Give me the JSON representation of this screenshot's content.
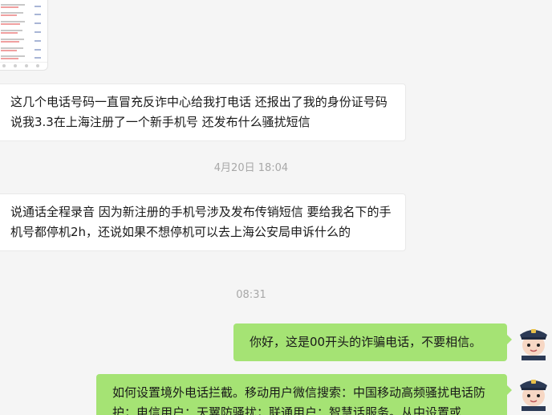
{
  "messages": [
    {
      "side": "in",
      "text": "这几个电话号码一直冒充反诈中心给我打电话 还报出了我的身份证号码 说我3.3在上海注册了一个新手机号 还发布什么骚扰短信"
    },
    {
      "side": "in",
      "text": "说通话全程录音 因为新注册的手机号涉及发布传销短信 要给我名下的手机号都停机2h，还说如果不想停机可以去上海公安局申诉什么的"
    },
    {
      "side": "out",
      "text": "你好，这是00开头的诈骗电话，不要相信。"
    },
    {
      "side": "out",
      "text": "如何设置境外电话拦截。移动用户微信搜索：中国移动高频骚扰电话防护；电信用户：天翼防骚扰；联通用户：智慧话服务。从中设置或"
    }
  ],
  "timestamps": [
    "4月20日 18:04",
    "08:31"
  ],
  "icons": {
    "avatar": "police-officer-avatar-icon",
    "thumbnail": "call-log-screenshot-thumbnail"
  },
  "colors": {
    "outgoing_bubble": "#a5e374",
    "incoming_bubble": "#ffffff",
    "background": "#f5f5f5",
    "timestamp": "#a8a8a8"
  }
}
